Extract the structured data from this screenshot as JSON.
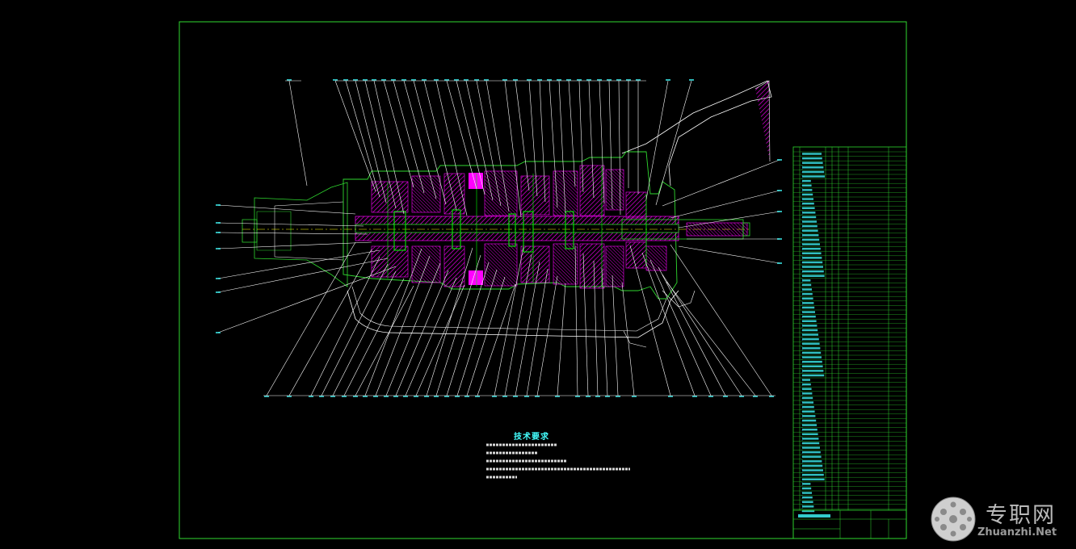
{
  "drawing": {
    "technical_requirements_title": "技术要求",
    "watermark_cn": "专职网",
    "watermark_en": "Zhuanzhi.Net"
  },
  "colors": {
    "frame": "#2fd82f",
    "lines": "#ffffff",
    "hatch": "#ff00ff",
    "green": "#00ff00",
    "cyan": "#40ffff",
    "yellow": "#ffff00"
  }
}
